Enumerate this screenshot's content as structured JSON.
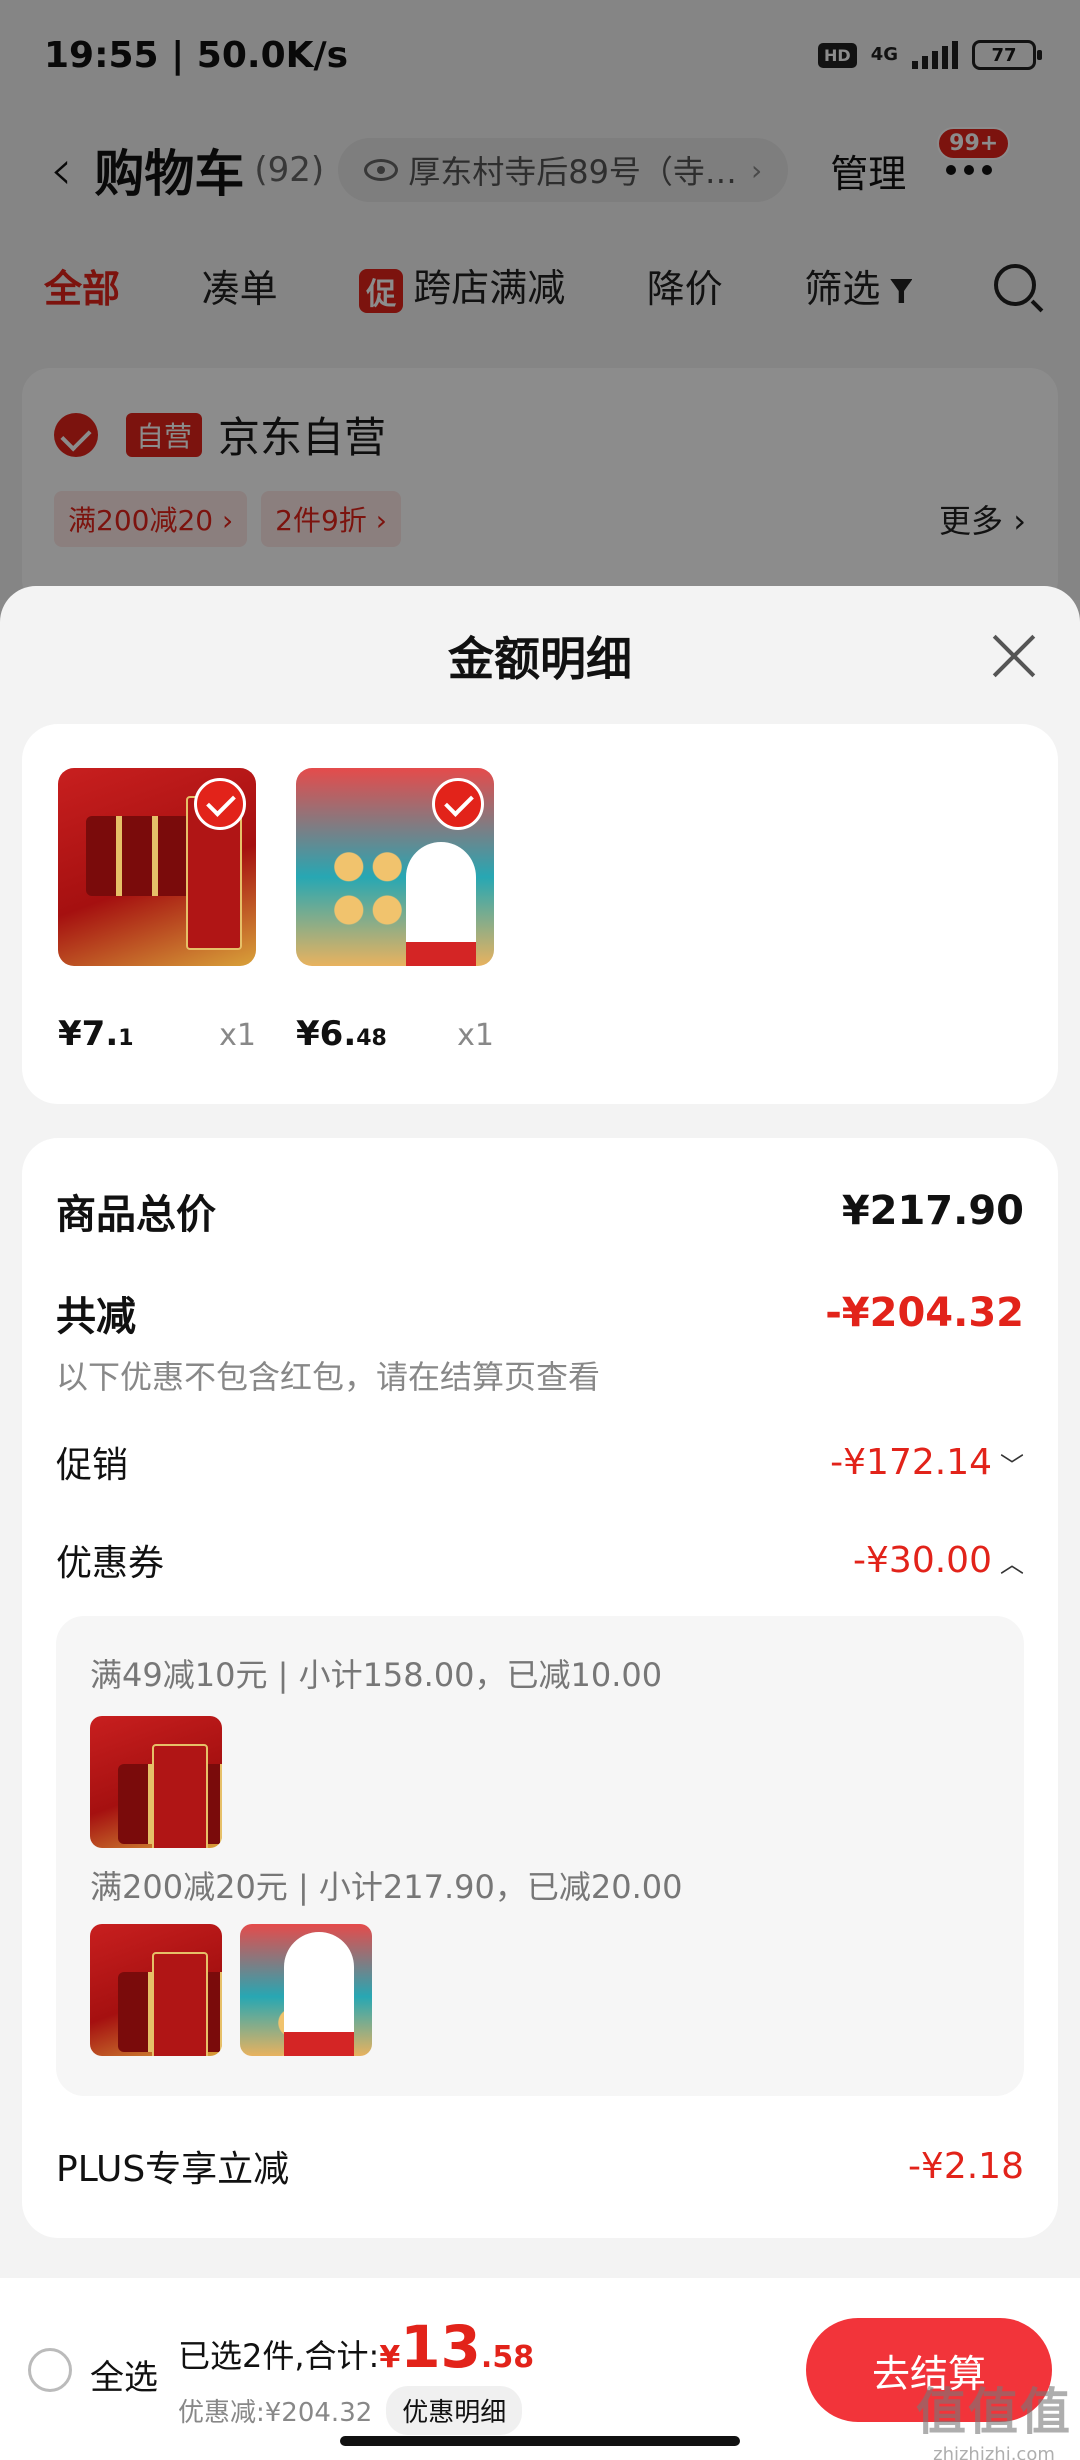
{
  "status_bar": {
    "time": "19:55 | 50.0K/s",
    "hd": "HD",
    "network": "4G",
    "battery": "77"
  },
  "header": {
    "title": "购物车",
    "count": "(92)",
    "address": "厚东村寺后89号（寺…",
    "manage": "管理",
    "badge": "99+"
  },
  "tabs": {
    "all": "全部",
    "combine": "凑单",
    "promo_tag": "促",
    "cross_store": "跨店满减",
    "price_drop": "降价",
    "filter": "筛选"
  },
  "shop": {
    "self_tag": "自营",
    "name": "京东自营",
    "coupons": [
      "满200减20 ›",
      "2件9折 ›"
    ],
    "more": "更多 ›"
  },
  "sheet": {
    "title": "金额明细",
    "items": [
      {
        "price_int": "¥7.",
        "price_dec": "1",
        "qty": "x1",
        "image": "disney-mooncake-gift-box"
      },
      {
        "price_int": "¥6.",
        "price_dec": "48",
        "qty": "x1",
        "image": "mooncake-gift-box"
      }
    ],
    "total_label": "商品总价",
    "total_value": "¥217.90",
    "discount_label": "共减",
    "discount_value": "-¥204.32",
    "discount_note": "以下优惠不包含红包，请在结算页查看",
    "promo_label": "促销",
    "promo_value": "-¥172.14",
    "coupon_label": "优惠券",
    "coupon_value": "-¥30.00",
    "coupon_rules": [
      "满49减10元 | 小计158.00，已减10.00",
      "满200减20元 | 小计217.90，已减20.00"
    ],
    "plus_label": "PLUS专享立减",
    "plus_value": "-¥2.18"
  },
  "bottom_bar": {
    "select_all": "全选",
    "selected_summary": "已选2件,合计:",
    "currency": "¥",
    "total_int": "13",
    "total_dec": ".58",
    "discount_text": "优惠减:¥204.32",
    "detail_chip": "优惠明细",
    "checkout": "去结算"
  },
  "watermark": {
    "big": "值值值",
    "small": "zhizhizhi.com"
  },
  "colors": {
    "accent": "#e2231a",
    "checkout": "#f2343a"
  }
}
